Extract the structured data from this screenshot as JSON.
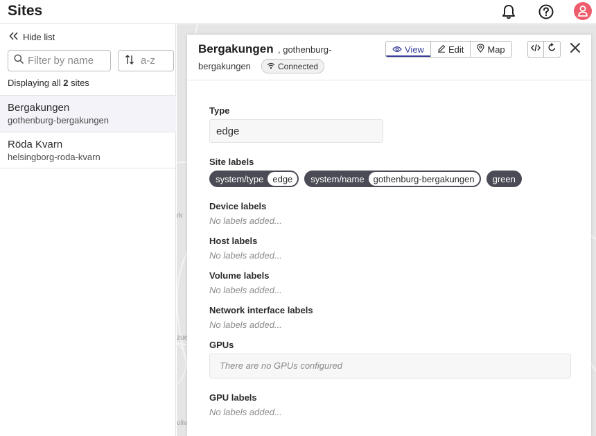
{
  "app": {
    "title": "Sites"
  },
  "sidebar": {
    "hide_list_label": "Hide list",
    "filter_placeholder": "Filter by name",
    "sort_label": "a-z",
    "displaying_prefix": "Displaying all",
    "displaying_count": "2",
    "displaying_suffix": "sites",
    "sites": [
      {
        "name": "Bergakungen",
        "slug": "gothenburg-bergakungen",
        "active": true
      },
      {
        "name": "Röda Kvarn",
        "slug": "helsingborg-roda-kvarn",
        "active": false
      }
    ]
  },
  "map": {
    "fragments": [
      "rk",
      "zue",
      "olivi"
    ]
  },
  "panel": {
    "site_name": "Bergakungen",
    "site_slug_part1": ", gothenburg-",
    "site_slug_part2": "bergakungen",
    "connection_status": "Connected",
    "tabs": [
      "View",
      "Edit",
      "Map"
    ],
    "active_tab": "View",
    "type_label": "Type",
    "type_value": "edge",
    "site_labels_label": "Site labels",
    "site_labels": [
      {
        "key": "system/type",
        "value": "edge"
      },
      {
        "key": "system/name",
        "value": "gothenburg-bergakungen"
      },
      {
        "key": "green",
        "value": ""
      }
    ],
    "device_labels_label": "Device labels",
    "host_labels_label": "Host labels",
    "volume_labels_label": "Volume labels",
    "network_labels_label": "Network interface labels",
    "gpus_label": "GPUs",
    "gpus_empty": "There are no GPUs configured",
    "gpu_labels_label": "GPU labels",
    "no_labels_text": "No labels added..."
  },
  "colors": {
    "accent": "#3a3f9a",
    "chip_bg": "#4a4b55",
    "avatar": "#ee5d6c"
  }
}
